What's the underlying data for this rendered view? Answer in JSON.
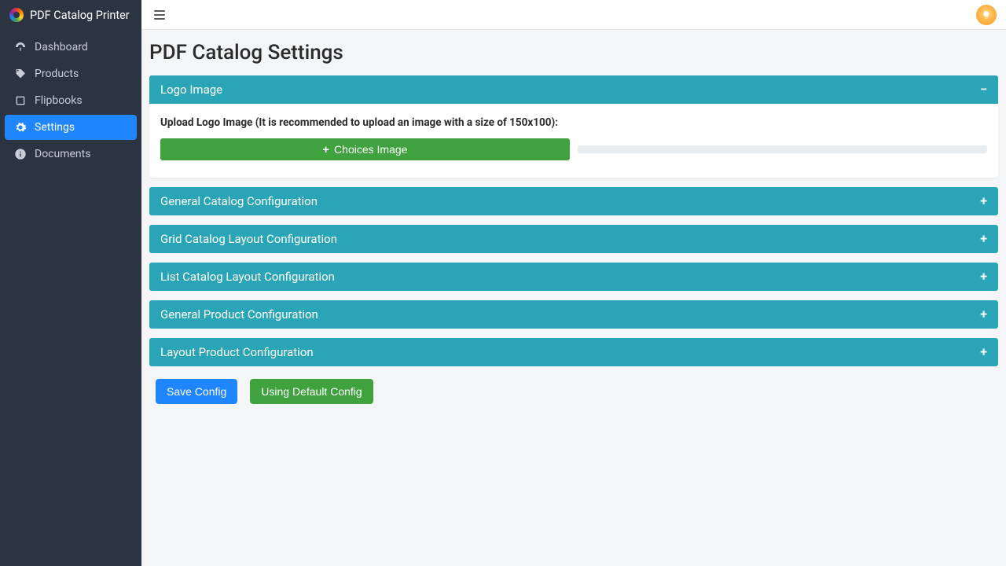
{
  "app": {
    "title": "PDF Catalog Printer"
  },
  "sidebar": {
    "items": [
      {
        "label": "Dashboard"
      },
      {
        "label": "Products"
      },
      {
        "label": "Flipbooks"
      },
      {
        "label": "Settings"
      },
      {
        "label": "Documents"
      }
    ]
  },
  "page": {
    "title": "PDF Catalog Settings"
  },
  "panels": [
    {
      "title": "Logo Image",
      "expanded": true,
      "uploadLabel": "Upload Logo Image (It is recommended to upload an image with a size of 150x100):",
      "buttonLabel": "Choices Image"
    },
    {
      "title": "General Catalog Configuration",
      "expanded": false
    },
    {
      "title": "Grid Catalog Layout Configuration",
      "expanded": false
    },
    {
      "title": "List Catalog Layout Configuration",
      "expanded": false
    },
    {
      "title": "General Product Configuration",
      "expanded": false
    },
    {
      "title": "Layout Product Configuration",
      "expanded": false
    }
  ],
  "actions": {
    "save": "Save Config",
    "default": "Using Default Config"
  },
  "colors": {
    "sidebarBg": "#2c3441",
    "sidebarActive": "#1f86ff",
    "panelHeader": "#2aa5b7",
    "btnPrimary": "#1f86ff",
    "btnSuccess": "#3fa23e"
  }
}
